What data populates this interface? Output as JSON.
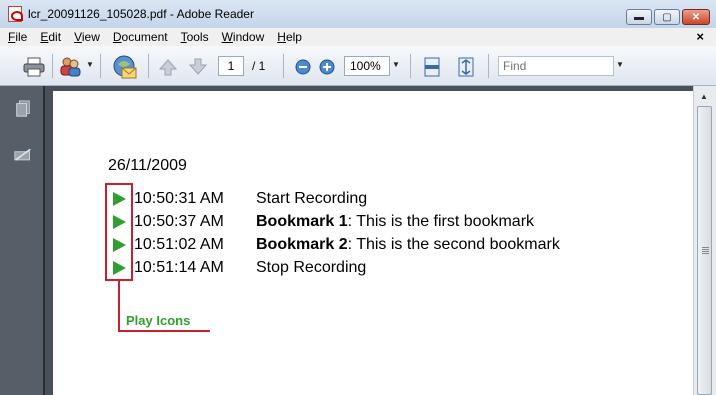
{
  "window": {
    "title": "lcr_20091126_105028.pdf - Adobe Reader",
    "minimize_glyph": "▬",
    "maximize_glyph": "▢",
    "close_glyph": "✕"
  },
  "menu": {
    "items": [
      {
        "underline": "F",
        "rest": "ile"
      },
      {
        "underline": "E",
        "rest": "dit"
      },
      {
        "underline": "V",
        "rest": "iew"
      },
      {
        "underline": "D",
        "rest": "ocument"
      },
      {
        "underline": "T",
        "rest": "ools"
      },
      {
        "underline": "W",
        "rest": "indow"
      },
      {
        "underline": "H",
        "rest": "elp"
      }
    ],
    "close_glyph": "×"
  },
  "toolbar": {
    "page_number": "1",
    "page_total": "/ 1",
    "zoom": "100%",
    "find_placeholder": "Find"
  },
  "document": {
    "date": "26/11/2009",
    "entries": [
      {
        "time": "10:50:31 AM",
        "bold": "",
        "text": "Start Recording"
      },
      {
        "time": "10:50:37 AM",
        "bold": "Bookmark 1",
        "text": ": This is the first bookmark"
      },
      {
        "time": "10:51:02 AM",
        "bold": "Bookmark 2",
        "text": ": This is the second bookmark"
      },
      {
        "time": "10:51:14 AM",
        "bold": "",
        "text": "Stop Recording"
      }
    ],
    "annotation_label": "Play Icons"
  },
  "colors": {
    "play_icon": "#2fa02f",
    "annotation_red": "#c8202f",
    "annotation_green": "#2fa02f"
  },
  "icons": [
    "pdf-icon",
    "print-icon",
    "collaborate-icon",
    "email-icon",
    "previous-page-icon",
    "next-page-icon",
    "zoom-out-icon",
    "zoom-in-icon",
    "fit-width-icon",
    "fit-page-icon",
    "pages-icon",
    "attachments-icon"
  ]
}
